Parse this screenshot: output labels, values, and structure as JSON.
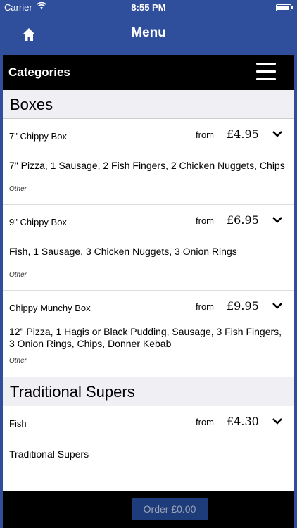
{
  "status_bar": {
    "carrier": "Carrier",
    "time": "8:55 PM"
  },
  "nav": {
    "title": "Menu"
  },
  "categories": {
    "label": "Categories"
  },
  "sections": [
    {
      "title": "Boxes",
      "items": [
        {
          "name": "7\" Chippy Box",
          "from": "from",
          "price": "£4.95",
          "description": "7\" Pizza, 1 Sausage, 2 Fish Fingers, 2 Chicken Nuggets, Chips",
          "tag": "Other"
        },
        {
          "name": "9\" Chippy Box",
          "from": "from",
          "price": "£6.95",
          "description": "Fish, 1 Sausage, 3 Chicken Nuggets, 3 Onion Rings",
          "tag": "Other"
        },
        {
          "name": "Chippy Munchy Box",
          "from": "from",
          "price": "£9.95",
          "description": "12\" Pizza, 1 Hagis or Black Pudding, Sausage, 3 Fish Fingers, 3 Onion Rings, Chips, Donner Kebab",
          "tag": "Other"
        }
      ]
    },
    {
      "title": "Traditional Supers",
      "items": [
        {
          "name": "Fish",
          "from": "from",
          "price": "£4.30",
          "description": "Traditional Supers"
        }
      ]
    }
  ],
  "order": {
    "label": "Order £0.00"
  },
  "icons": {
    "home": "home-icon",
    "menu": "hamburger-menu-icon",
    "expand": "chevron-down-icon",
    "wifi": "wifi-icon",
    "battery": "battery-icon"
  }
}
